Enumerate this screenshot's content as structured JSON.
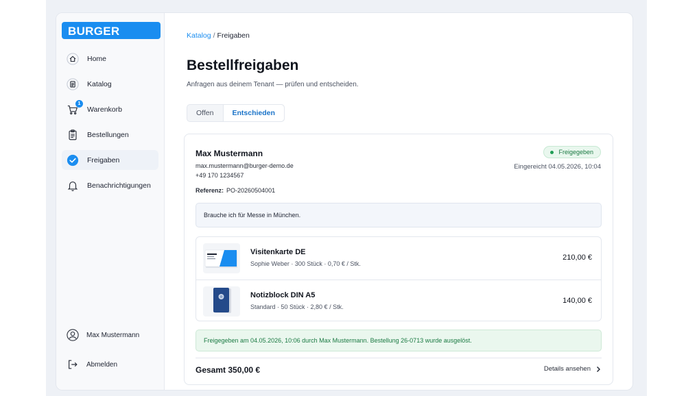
{
  "brand": {
    "logo_text": "BURGER",
    "accent": "#1a8df0"
  },
  "sidebar": {
    "items": [
      {
        "label": "Home",
        "icon": "home-icon"
      },
      {
        "label": "Katalog",
        "icon": "catalog-icon"
      },
      {
        "label": "Warenkorb",
        "icon": "cart-icon",
        "badge": "1"
      },
      {
        "label": "Bestellungen",
        "icon": "clipboard-icon"
      },
      {
        "label": "Freigaben",
        "icon": "check-circle-icon",
        "active": true
      },
      {
        "label": "Benachrichtigungen",
        "icon": "bell-icon"
      }
    ],
    "user_name": "Max Mustermann",
    "logout_label": "Abmelden"
  },
  "breadcrumb": {
    "parent": "Katalog",
    "separator": "/",
    "current": "Freigaben"
  },
  "page": {
    "title": "Bestellfreigaben",
    "subtitle": "Anfragen aus deinem Tenant — prüfen und entscheiden."
  },
  "tabs": [
    {
      "label": "Offen",
      "selected": false
    },
    {
      "label": "Entschieden",
      "selected": true
    }
  ],
  "request": {
    "name": "Max Mustermann",
    "email": "max.mustermann@burger-demo.de",
    "phone": "+49 170 1234567",
    "reference_label": "Referenz:",
    "reference_value": "PO-20260504001",
    "status": "Freigegeben",
    "status_color": "#1f9d55",
    "submitted": "Eingereicht 04.05.2026, 10:04",
    "note": "Brauche ich für Messe in München.",
    "items": [
      {
        "name": "Visitenkarte DE",
        "meta": "Sophie Weber · 300 Stück · 0,70 € / Stk.",
        "price": "210,00 €"
      },
      {
        "name": "Notizblock DIN A5",
        "meta": "Standard · 50 Stück · 2,80 € / Stk.",
        "price": "140,00 €"
      }
    ],
    "approval_message": "Freigegeben am 04.05.2026, 10:06 durch Max Mustermann. Bestellung 26-0713 wurde ausgelöst.",
    "total": "Gesamt 350,00 €",
    "details_label": "Details ansehen"
  }
}
